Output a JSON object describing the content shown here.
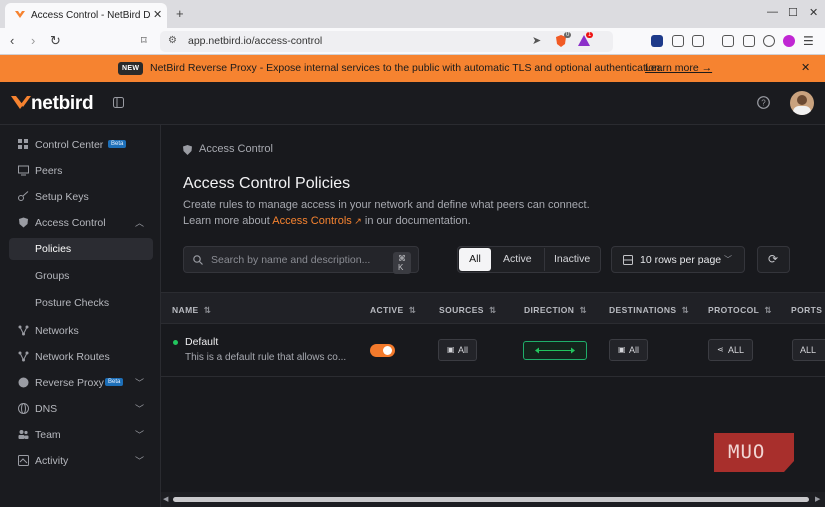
{
  "browser": {
    "tab_title": "Access Control - NetBird Dashboard",
    "url": "app.netbird.io/access-control",
    "shield_count": "0",
    "alert_count": "1"
  },
  "banner": {
    "badge": "NEW",
    "message": "NetBird Reverse Proxy - Expose internal services to the public with automatic TLS and optional authentication.",
    "link": "Learn more →"
  },
  "header": {
    "brand": "netbird"
  },
  "sidebar": {
    "items": [
      {
        "label": "Control Center",
        "badge": "Beta",
        "icon": "grid-icon"
      },
      {
        "label": "Peers",
        "icon": "monitor-icon"
      },
      {
        "label": "Setup Keys",
        "icon": "key-icon"
      },
      {
        "label": "Access Control",
        "icon": "shield-icon"
      },
      {
        "label": "Policies"
      },
      {
        "label": "Groups"
      },
      {
        "label": "Posture Checks"
      },
      {
        "label": "Networks",
        "icon": "network-icon"
      },
      {
        "label": "Network Routes",
        "icon": "route-icon"
      },
      {
        "label": "Reverse Proxy",
        "badge": "Beta",
        "icon": "globe-icon"
      },
      {
        "label": "DNS",
        "icon": "globe-icon"
      },
      {
        "label": "Team",
        "icon": "team-icon"
      },
      {
        "label": "Activity",
        "icon": "activity-icon"
      }
    ]
  },
  "main": {
    "breadcrumb": "Access Control",
    "title": "Access Control Policies",
    "desc_line1": "Create rules to manage access in your network and define what peers can connect.",
    "desc_prefix": "Learn more about ",
    "desc_link": "Access Controls",
    "desc_suffix": " in our documentation.",
    "search_placeholder": "Search by name and description...",
    "search_shortcut": "⌘ K",
    "filters": [
      "All",
      "Active",
      "Inactive"
    ],
    "active_filter": "All",
    "rows_per_page": "10 rows per page"
  },
  "table": {
    "columns": [
      "NAME",
      "ACTIVE",
      "SOURCES",
      "DIRECTION",
      "DESTINATIONS",
      "PROTOCOL",
      "PORTS"
    ],
    "rows": [
      {
        "name": "Default",
        "description": "This is a default rule that allows co...",
        "active": true,
        "sources": "All",
        "destinations": "All",
        "protocol": "ALL",
        "ports": "ALL"
      }
    ]
  },
  "watermark": "MUO",
  "colors": {
    "accent": "#f68330",
    "toggle": "#f37a2c",
    "status_green": "#22c55e",
    "direction_border": "#1fae6a"
  }
}
